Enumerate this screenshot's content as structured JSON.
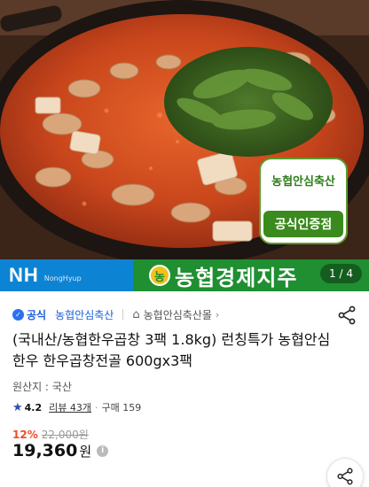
{
  "hero": {
    "image": "korean-beef-tripe-stew-hotpot-photo",
    "cert_badge": {
      "top_text": "농협안심축산",
      "bottom_text": "공식인증점"
    }
  },
  "banner": {
    "logo_text": "NH",
    "logo_sub": "NongHyup",
    "coop_icon_text": "농",
    "coop_name": "농협경제지주",
    "page_counter": "1 / 4"
  },
  "store": {
    "official_label": "공식",
    "store_name": "농협안심축산",
    "mall_name": "농협안심축산몰"
  },
  "product": {
    "title": "(국내산/농협한우곱창 3팩 1.8kg) 런칭특가 농협안심한우 한우곱창전골 600gx3팩",
    "origin": "원산지 : 국산",
    "rating": "4.2",
    "reviews": "리뷰 43개",
    "purchases": "구매 159",
    "discount": "12%",
    "original_price": "22,000원",
    "price": "19,360",
    "price_unit": "원"
  },
  "colors": {
    "accent_blue": "#1a5fd9",
    "banner_green": "#1f8f31",
    "banner_blue": "#0d83d4",
    "discount_red": "#f04d23",
    "star_blue": "#2a4fb8"
  },
  "icons": {
    "official": "check-shield-icon",
    "home": "home-icon",
    "share": "share-icon",
    "star": "star-icon",
    "info": "info-icon"
  }
}
